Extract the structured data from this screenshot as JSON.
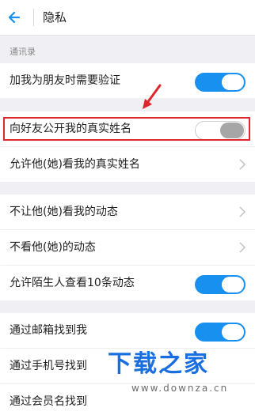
{
  "header": {
    "title": "隐私"
  },
  "sections": {
    "contacts_label": "通讯录"
  },
  "rows": {
    "verify": {
      "label": "加我为朋友时需要验证",
      "toggle": "on"
    },
    "realname_public": {
      "label": "向好友公开我的真实姓名",
      "toggle": "off"
    },
    "allow_view_realname": {
      "label": "允许他(她)看我的真实姓名"
    },
    "hide_my_moments": {
      "label": "不让他(她)看我的动态"
    },
    "hide_their_moments": {
      "label": "不看他(她)的动态"
    },
    "stranger_view": {
      "label": "允许陌生人查看10条动态",
      "toggle": "on"
    },
    "find_by_email": {
      "label": "通过邮箱找到我",
      "toggle": "on"
    },
    "find_by_phone": {
      "label": "通过手机号找到"
    },
    "find_by_member": {
      "label": "通过会员名找到"
    }
  },
  "watermark": {
    "title": "下载之家",
    "url": "www.downza.cn"
  },
  "colors": {
    "accent": "#1890f0",
    "highlight": "#e0262d",
    "watermark": "#1a6fe0"
  }
}
